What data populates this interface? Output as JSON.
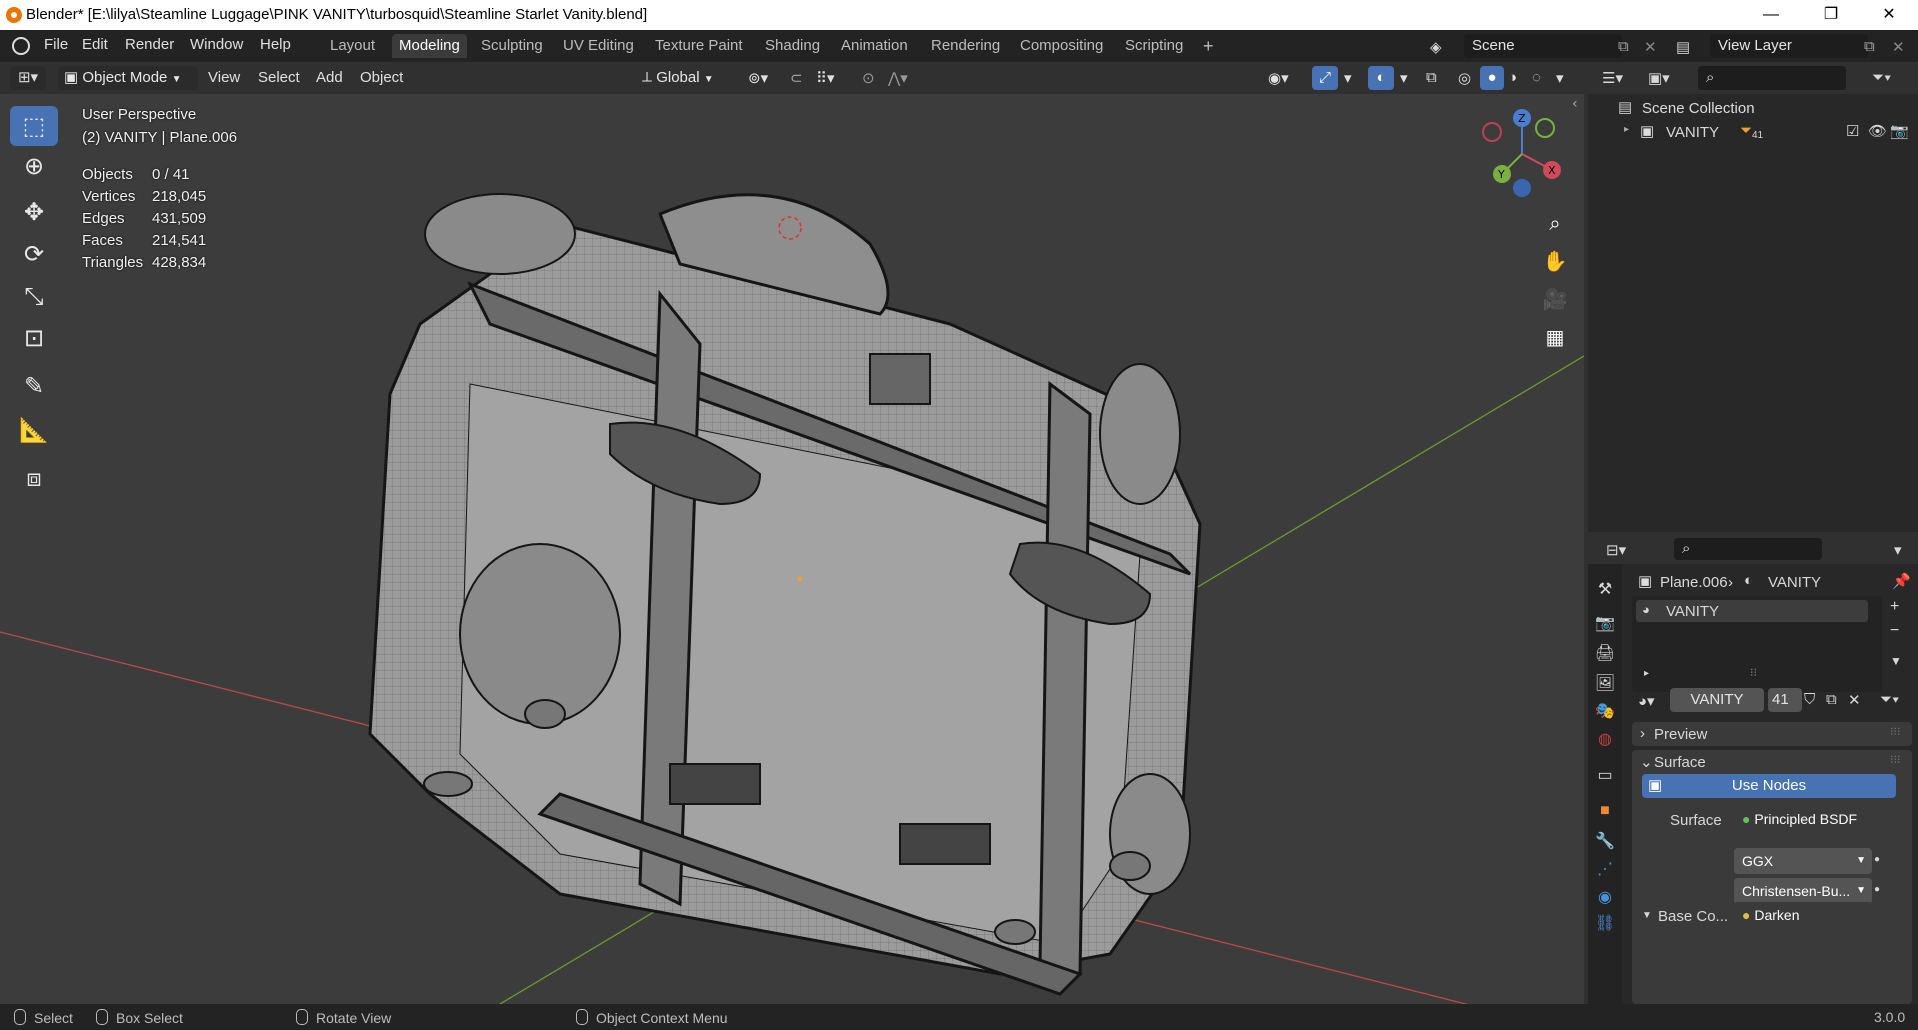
{
  "window": {
    "title": "Blender* [E:\\lilya\\Steamline Luggage\\PINK VANITY\\turbosquid\\Steamline Starlet  Vanity.blend]",
    "minimize": "—",
    "maximize": "❐",
    "close": "✕"
  },
  "menubar": {
    "items": [
      "File",
      "Edit",
      "Render",
      "Window",
      "Help"
    ],
    "workspaces": [
      "Layout",
      "Modeling",
      "Sculpting",
      "UV Editing",
      "Texture Paint",
      "Shading",
      "Animation",
      "Rendering",
      "Compositing",
      "Scripting"
    ],
    "active_workspace": "Modeling",
    "add_workspace": "+",
    "scene": "Scene",
    "view_layer": "View Layer"
  },
  "view_header": {
    "mode": "Object Mode",
    "menus": [
      "View",
      "Select",
      "Add",
      "Object"
    ],
    "orientation": "Global"
  },
  "viewport": {
    "perspective": "User Perspective",
    "context": "(2) VANITY | Plane.006",
    "stats": [
      {
        "label": "Objects",
        "value": "0 / 41"
      },
      {
        "label": "Vertices",
        "value": "218,045"
      },
      {
        "label": "Edges",
        "value": "431,509"
      },
      {
        "label": "Faces",
        "value": "214,541"
      },
      {
        "label": "Triangles",
        "value": "428,834"
      }
    ],
    "gizmo": {
      "z": "Z",
      "y": "Y",
      "x": "X"
    }
  },
  "outliner": {
    "collection": "Scene Collection",
    "items": [
      {
        "name": "VANITY",
        "count": "41"
      }
    ]
  },
  "properties": {
    "breadcrumb_object": "Plane.006",
    "breadcrumb_material": "VANITY",
    "material_slot": "VANITY",
    "material_name": "VANITY",
    "material_users": "41",
    "panels": {
      "preview": "Preview",
      "surface": "Surface"
    },
    "use_nodes": "Use Nodes",
    "surface_label": "Surface",
    "surface_value": "Principled BSDF",
    "distribution": "GGX",
    "subsurface": "Christensen-Bu...",
    "base_color_label": "Base Co...",
    "base_color_value": "Darken"
  },
  "statusbar": {
    "select": "Select",
    "box_select": "Box Select",
    "rotate": "Rotate View",
    "context_menu": "Object Context Menu",
    "version": "3.0.0"
  }
}
